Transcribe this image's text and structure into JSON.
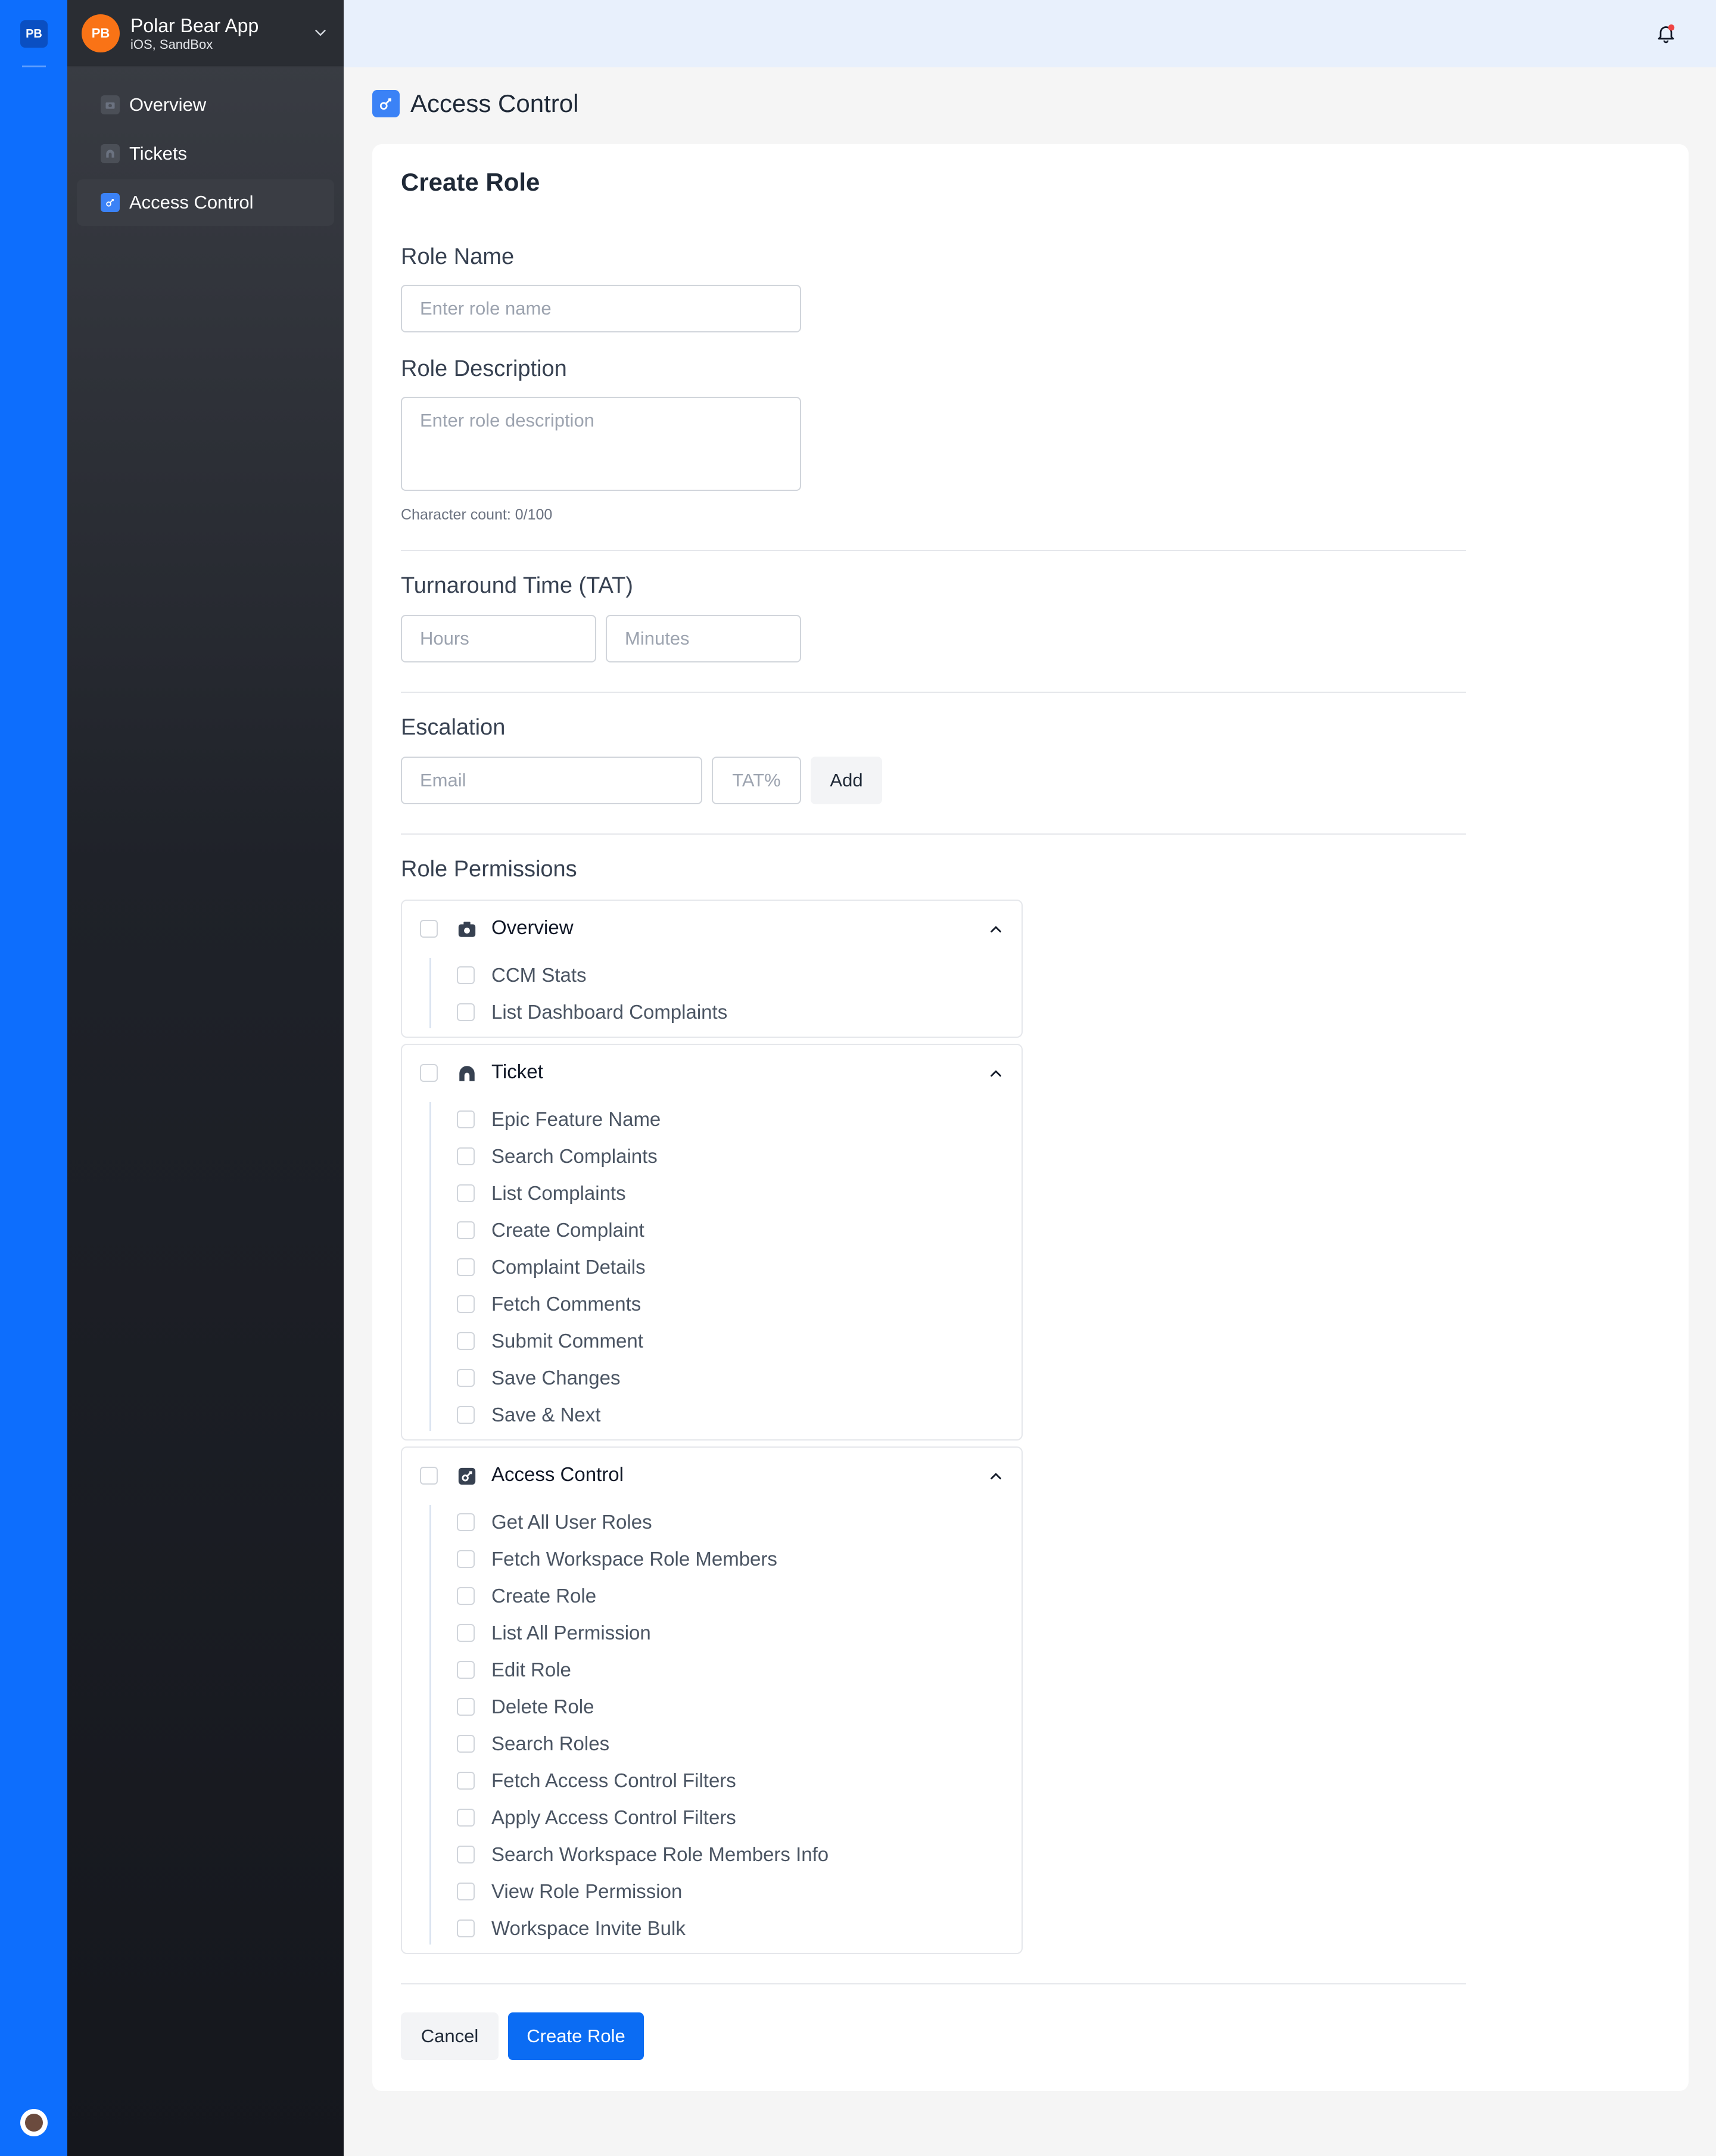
{
  "app": {
    "rail_badge": "PB",
    "logo_initials": "PB",
    "name": "Polar Bear App",
    "subtitle": "iOS, SandBox"
  },
  "sidebar": {
    "items": [
      {
        "label": "Overview",
        "icon": "camera-icon",
        "active": false
      },
      {
        "label": "Tickets",
        "icon": "ticket-icon",
        "active": false
      },
      {
        "label": "Access Control",
        "icon": "key-icon",
        "active": true
      }
    ]
  },
  "page": {
    "title": "Access Control"
  },
  "form": {
    "heading": "Create Role",
    "role_name": {
      "label": "Role Name",
      "placeholder": "Enter role name",
      "value": ""
    },
    "role_description": {
      "label": "Role Description",
      "placeholder": "Enter role description",
      "value": "",
      "char_count": "Character count: 0/100"
    },
    "tat": {
      "label": "Turnaround Time (TAT)",
      "hours_placeholder": "Hours",
      "minutes_placeholder": "Minutes"
    },
    "escalation": {
      "label": "Escalation",
      "email_placeholder": "Email",
      "tat_placeholder": "TAT%",
      "add_label": "Add"
    },
    "permissions_label": "Role Permissions",
    "cancel_label": "Cancel",
    "submit_label": "Create Role"
  },
  "permission_groups": [
    {
      "title": "Overview",
      "icon": "camera-icon",
      "expanded": true,
      "items": [
        "CCM Stats",
        "List Dashboard Complaints"
      ]
    },
    {
      "title": "Ticket",
      "icon": "ticket-icon",
      "expanded": true,
      "items": [
        "Epic Feature Name",
        "Search Complaints",
        "List Complaints",
        "Create Complaint",
        "Complaint Details",
        "Fetch Comments",
        "Submit Comment",
        "Save Changes",
        "Save & Next"
      ]
    },
    {
      "title": "Access Control",
      "icon": "key-icon",
      "expanded": true,
      "items": [
        "Get All User Roles",
        "Fetch Workspace Role Members",
        "Create Role",
        "List All Permission",
        "Edit Role",
        "Delete Role",
        "Search Roles",
        "Fetch Access Control Filters",
        "Apply Access Control Filters",
        "Search Workspace Role Members Info",
        "View Role Permission",
        "Workspace Invite Bulk"
      ]
    }
  ],
  "colors": {
    "rail": "#0d6efd",
    "accent": "#0b6cf3",
    "logo": "#f97316",
    "notification_dot": "#ef4444"
  }
}
